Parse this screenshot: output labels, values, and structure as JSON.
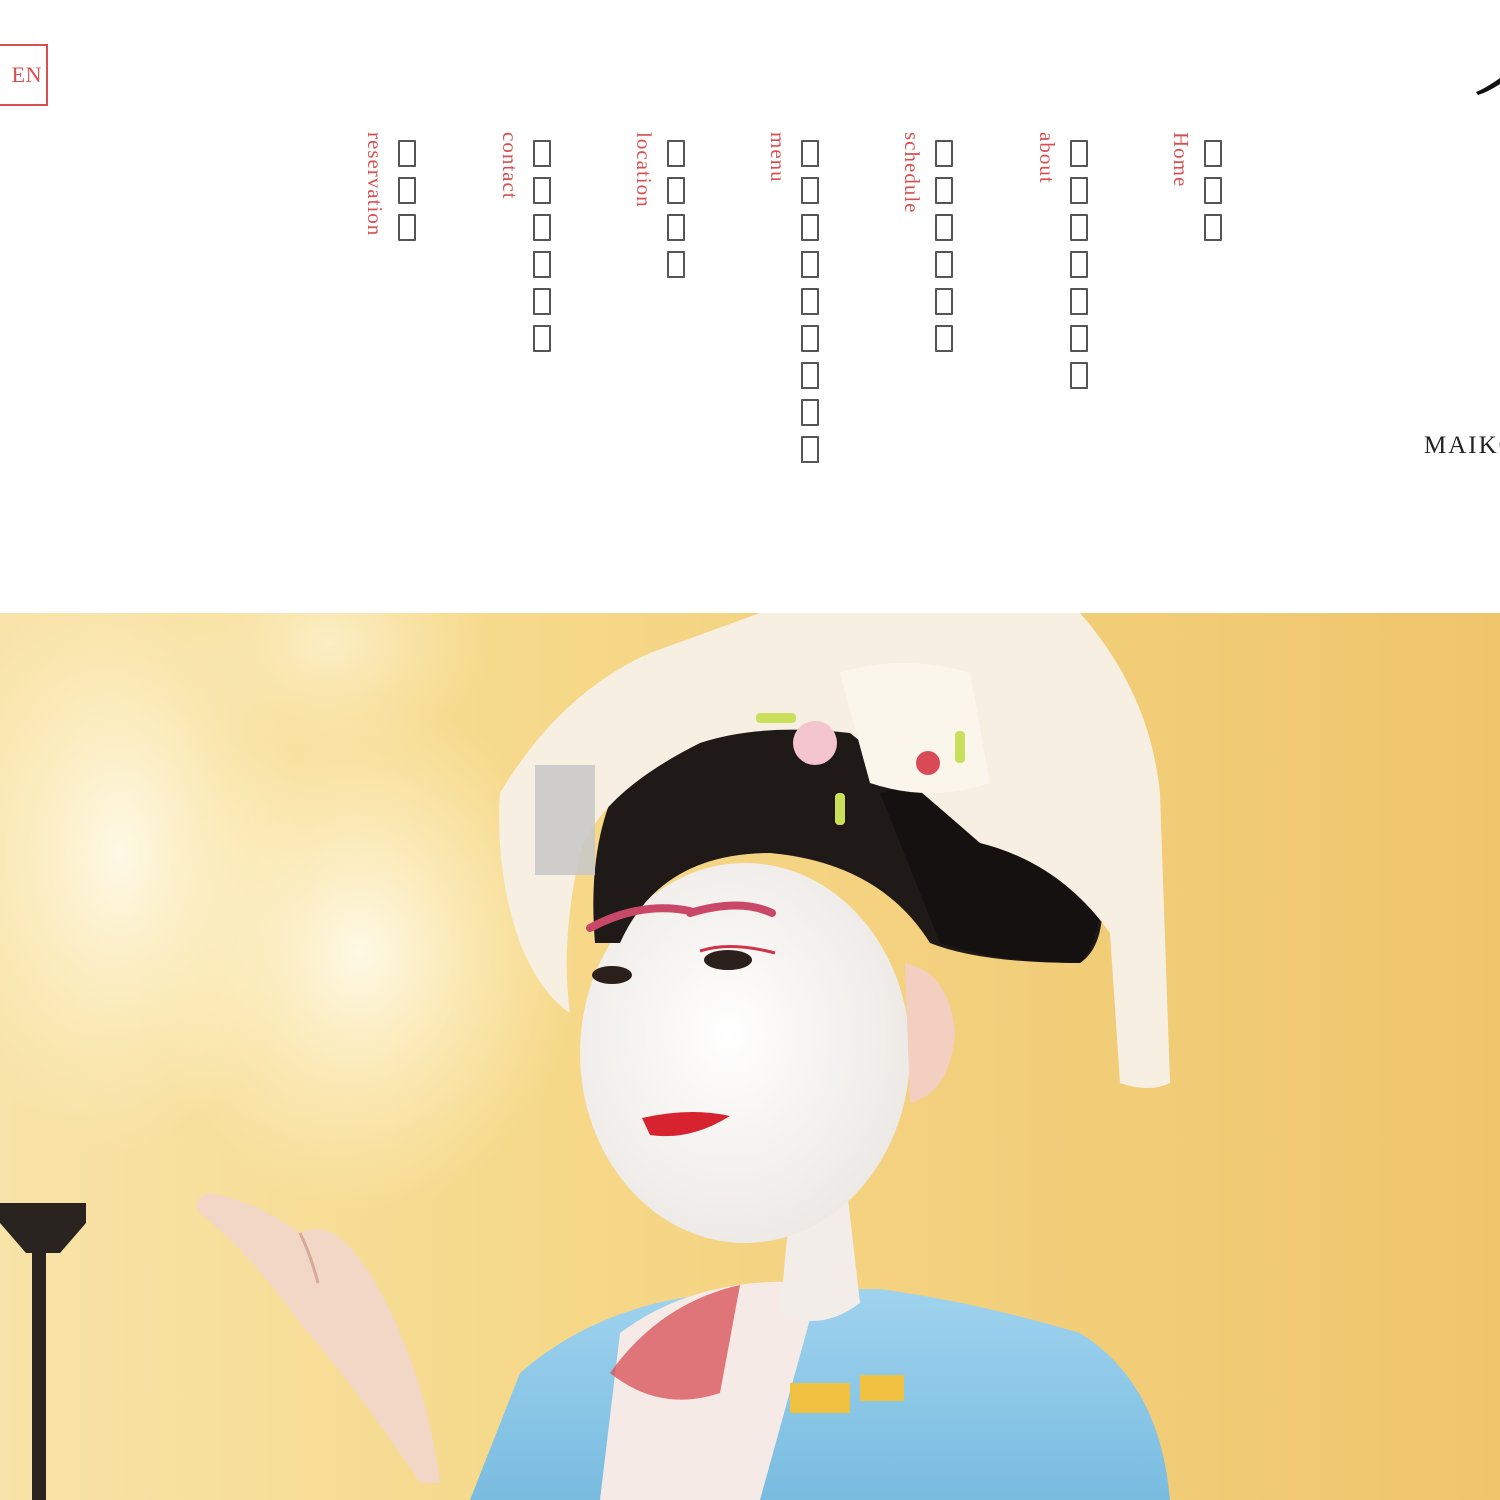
{
  "language_toggle": {
    "label": "EN"
  },
  "nav": {
    "items": [
      {
        "en": "Home",
        "ja_chars": 3
      },
      {
        "en": "about",
        "ja_chars": 7
      },
      {
        "en": "schedule",
        "ja_chars": 6
      },
      {
        "en": "menu",
        "ja_chars": 9
      },
      {
        "en": "location",
        "ja_chars": 4
      },
      {
        "en": "contact",
        "ja_chars": 6
      },
      {
        "en": "reservation",
        "ja_chars": 3
      }
    ]
  },
  "brand": {
    "text": "MAIKO"
  },
  "colors": {
    "accent": "#d94f4f",
    "nav_glyph": "#555555",
    "hero_background": "#f3cf7a",
    "kimono": "#8cc9e6"
  }
}
